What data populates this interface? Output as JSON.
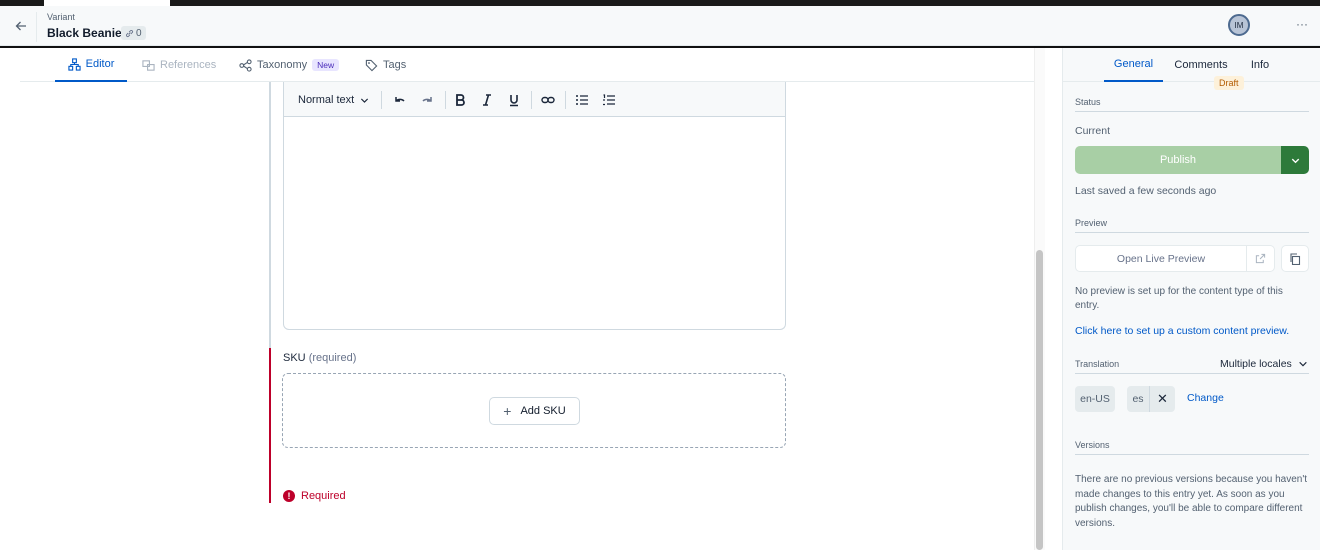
{
  "header": {
    "entry_type": "Variant",
    "entry_title": "Black Beanie",
    "references_count": "0",
    "avatar_initials": "IM",
    "more_label": "···"
  },
  "main_tabs": [
    {
      "label": "Editor",
      "icon": "editor-icon",
      "state": "active"
    },
    {
      "label": "References",
      "icon": "references-icon",
      "state": "disabled"
    },
    {
      "label": "Taxonomy",
      "icon": "taxonomy-icon",
      "badge": "New"
    },
    {
      "label": "Tags",
      "icon": "tag-icon"
    }
  ],
  "rich_text_toolbar": {
    "format_select": "Normal text",
    "buttons": [
      "undo-icon",
      "redo-icon",
      "bold-icon",
      "italic-icon",
      "underline-icon",
      "link-icon",
      "bulleted-list-icon",
      "numbered-list-icon"
    ]
  },
  "sku_field": {
    "label": "SKU",
    "required_hint": "(required)",
    "add_button": "Add SKU",
    "validation_message": "Required"
  },
  "sidebar": {
    "tabs": [
      "General",
      "Comments",
      "Info"
    ],
    "status": {
      "heading": "Status",
      "current_label": "Current",
      "badge": "Draft",
      "publish_label": "Publish",
      "last_saved": "Last saved a few seconds ago"
    },
    "preview": {
      "heading": "Preview",
      "open_label": "Open Live Preview",
      "note": "No preview is set up for the content type of this entry.",
      "link": "Click here to set up a custom content preview."
    },
    "translation": {
      "heading": "Translation",
      "mode": "Multiple locales",
      "locales": [
        "en-US",
        "es"
      ],
      "change_label": "Change"
    },
    "versions": {
      "heading": "Versions",
      "text": "There are no previous versions because you haven't made changes to this entry yet. As soon as you publish changes, you'll be able to compare different versions."
    }
  },
  "colors": {
    "accent": "#0059c8",
    "publish_disabled": "#a8cfa5",
    "publish_dark": "#2d7a3a",
    "error": "#bd002a",
    "draft_badge": "#fdf1da"
  }
}
